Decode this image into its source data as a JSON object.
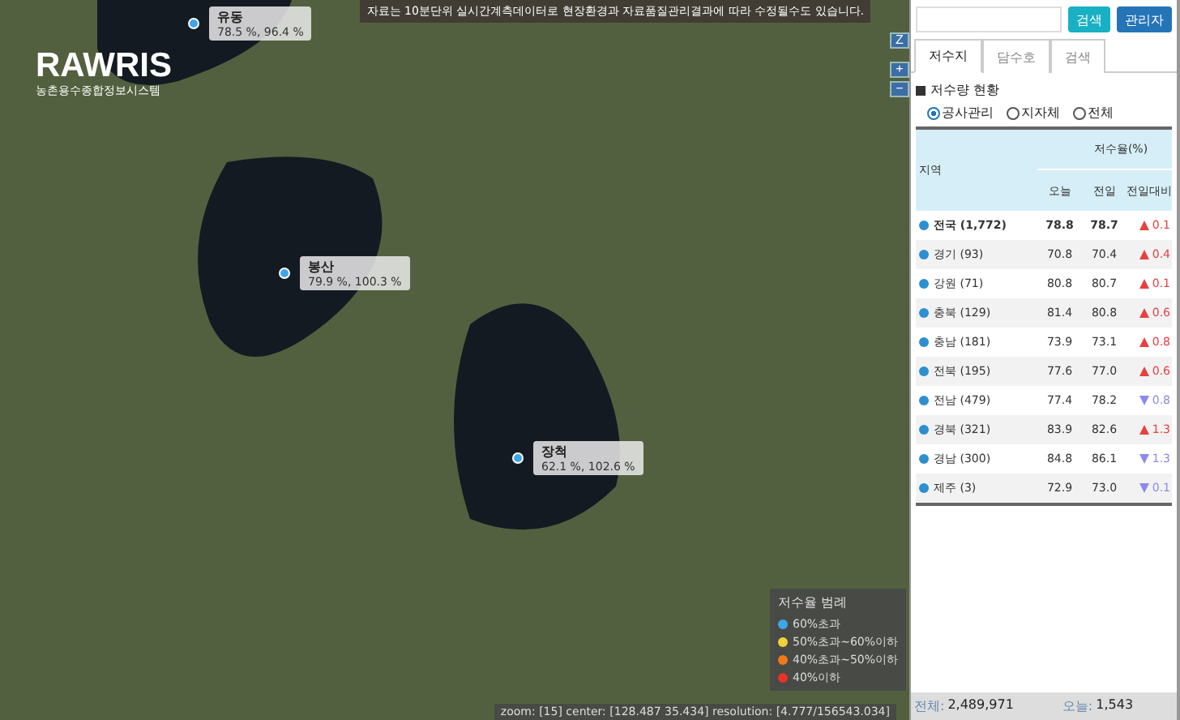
{
  "map": {
    "logo": {
      "name": "RAWRIS",
      "subtitle": "농촌용수종합정보시스템"
    },
    "notice": "자료는 10분단위 실시간계측데이터로 현장환경과 자료품질관리결과에 따라 수정될수도 있습니다.",
    "controls": [
      "Z",
      "+",
      "−"
    ],
    "markers": [
      {
        "name": "유동",
        "values": "78.5 %, 96.4 %"
      },
      {
        "name": "봉산",
        "values": "79.9 %, 100.3 %"
      },
      {
        "name": "장척",
        "values": "62.1 %, 102.6 %"
      }
    ],
    "legend": {
      "title": "저수율 범례",
      "items": [
        {
          "label": "60%초과",
          "color": "#3ea6e6"
        },
        {
          "label": "50%초과~60%이하",
          "color": "#f2d13a"
        },
        {
          "label": "40%초과~50%이하",
          "color": "#f07a1a"
        },
        {
          "label": "40%이하",
          "color": "#e8322a"
        }
      ]
    },
    "status": "zoom: [15] center: [128.487 35.434] resolution: [4.777/156543.034]"
  },
  "panel": {
    "search": {
      "buttons": [
        "검색",
        "관리자"
      ]
    },
    "tabs": [
      {
        "label": "저수지",
        "selected": true
      },
      {
        "label": "담수호",
        "selected": false
      },
      {
        "label": "검색",
        "selected": false
      }
    ],
    "heading": "저수량 현황",
    "filters": [
      {
        "label": "공사관리",
        "selected": true
      },
      {
        "label": "지자체",
        "selected": false
      },
      {
        "label": "전체",
        "selected": false
      }
    ],
    "table": {
      "region_header": "지역",
      "group_header": "저수율(%)",
      "columns": [
        "오늘",
        "전일",
        "전일대비"
      ],
      "rows": [
        {
          "region": "전국 (1,772)",
          "today": "78.8",
          "yesterday": "78.7",
          "rising": true,
          "change": "0.1"
        },
        {
          "region": "경기 (93)",
          "today": "70.8",
          "yesterday": "70.4",
          "rising": true,
          "change": "0.4"
        },
        {
          "region": "강원 (71)",
          "today": "80.8",
          "yesterday": "80.7",
          "rising": true,
          "change": "0.1"
        },
        {
          "region": "충북 (129)",
          "today": "81.4",
          "yesterday": "80.8",
          "rising": true,
          "change": "0.6"
        },
        {
          "region": "충남 (181)",
          "today": "73.9",
          "yesterday": "73.1",
          "rising": true,
          "change": "0.8"
        },
        {
          "region": "전북 (195)",
          "today": "77.6",
          "yesterday": "77.0",
          "rising": true,
          "change": "0.6"
        },
        {
          "region": "전남 (479)",
          "today": "77.4",
          "yesterday": "78.2",
          "rising": false,
          "change": "0.8"
        },
        {
          "region": "경북 (321)",
          "today": "83.9",
          "yesterday": "82.6",
          "rising": true,
          "change": "1.3"
        },
        {
          "region": "경남 (300)",
          "today": "84.8",
          "yesterday": "86.1",
          "rising": false,
          "change": "1.3"
        },
        {
          "region": "제주 (3)",
          "today": "72.9",
          "yesterday": "73.0",
          "rising": false,
          "change": "0.1"
        }
      ]
    },
    "footer": [
      {
        "label": "전체:",
        "value": "2,489,971"
      },
      {
        "label": "오늘:",
        "value": "1,543"
      }
    ]
  }
}
